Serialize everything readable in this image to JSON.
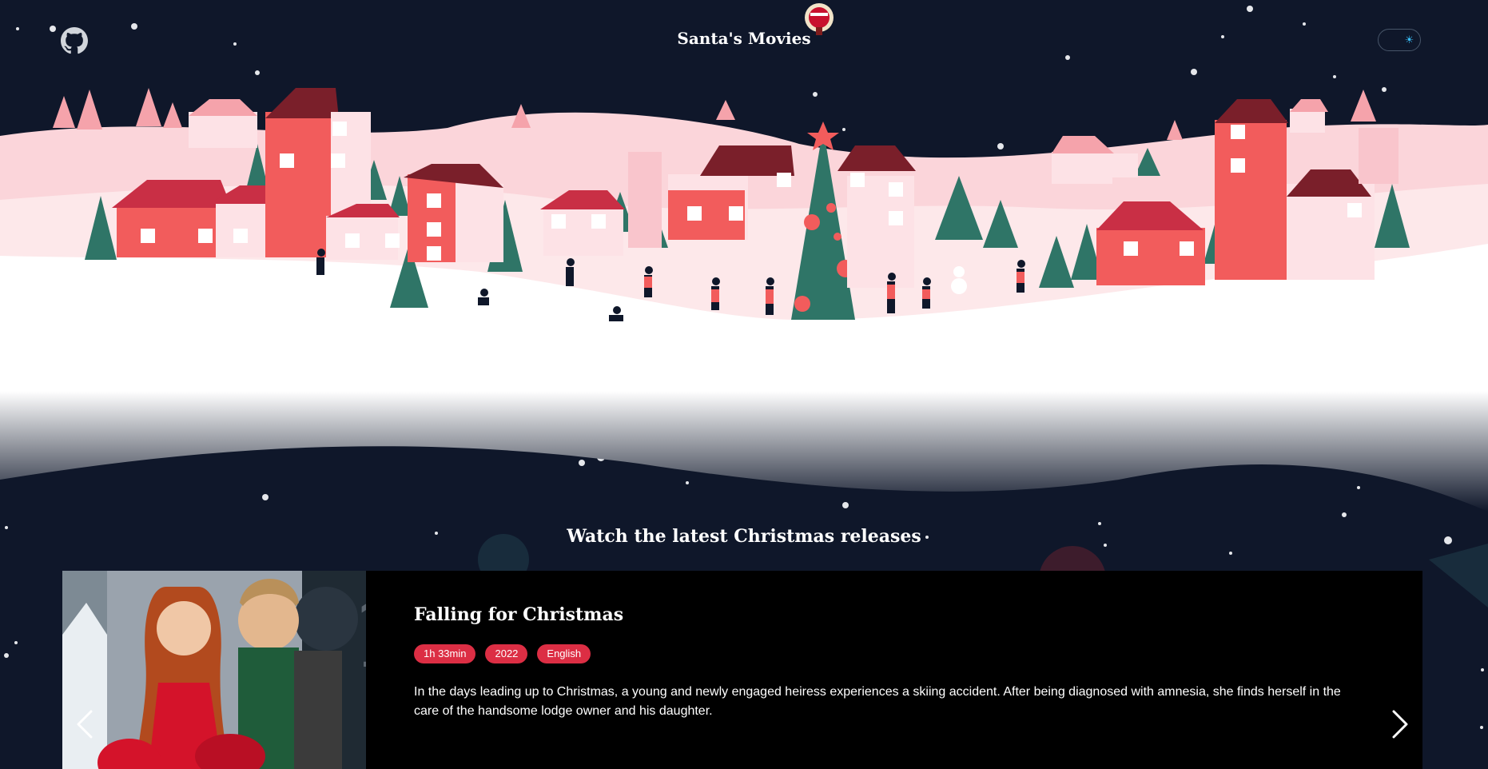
{
  "header": {
    "title": "Santa's Movies",
    "github_icon": "github-icon",
    "theme_toggle_icon": "sun-icon"
  },
  "section": {
    "title": "Watch the latest Christmas releases"
  },
  "carousel": {
    "current": {
      "title": "Falling for Christmas",
      "duration": "1h 33min",
      "year": "2022",
      "language": "English",
      "description": "In the days leading up to Christmas, a young and newly engaged heiress experiences a skiing accident. After being diagnosed with amnesia, she finds herself in the care of the handsome lodge owner and his daughter."
    },
    "prev_icon": "chevron-left-icon",
    "next_icon": "chevron-right-icon"
  },
  "colors": {
    "background": "#0f172a",
    "accent": "#dc2e44",
    "snow": "#ffffff",
    "village_red": "#f25c5c",
    "village_pink": "#f9c5cc",
    "tree_green": "#2f7567"
  }
}
